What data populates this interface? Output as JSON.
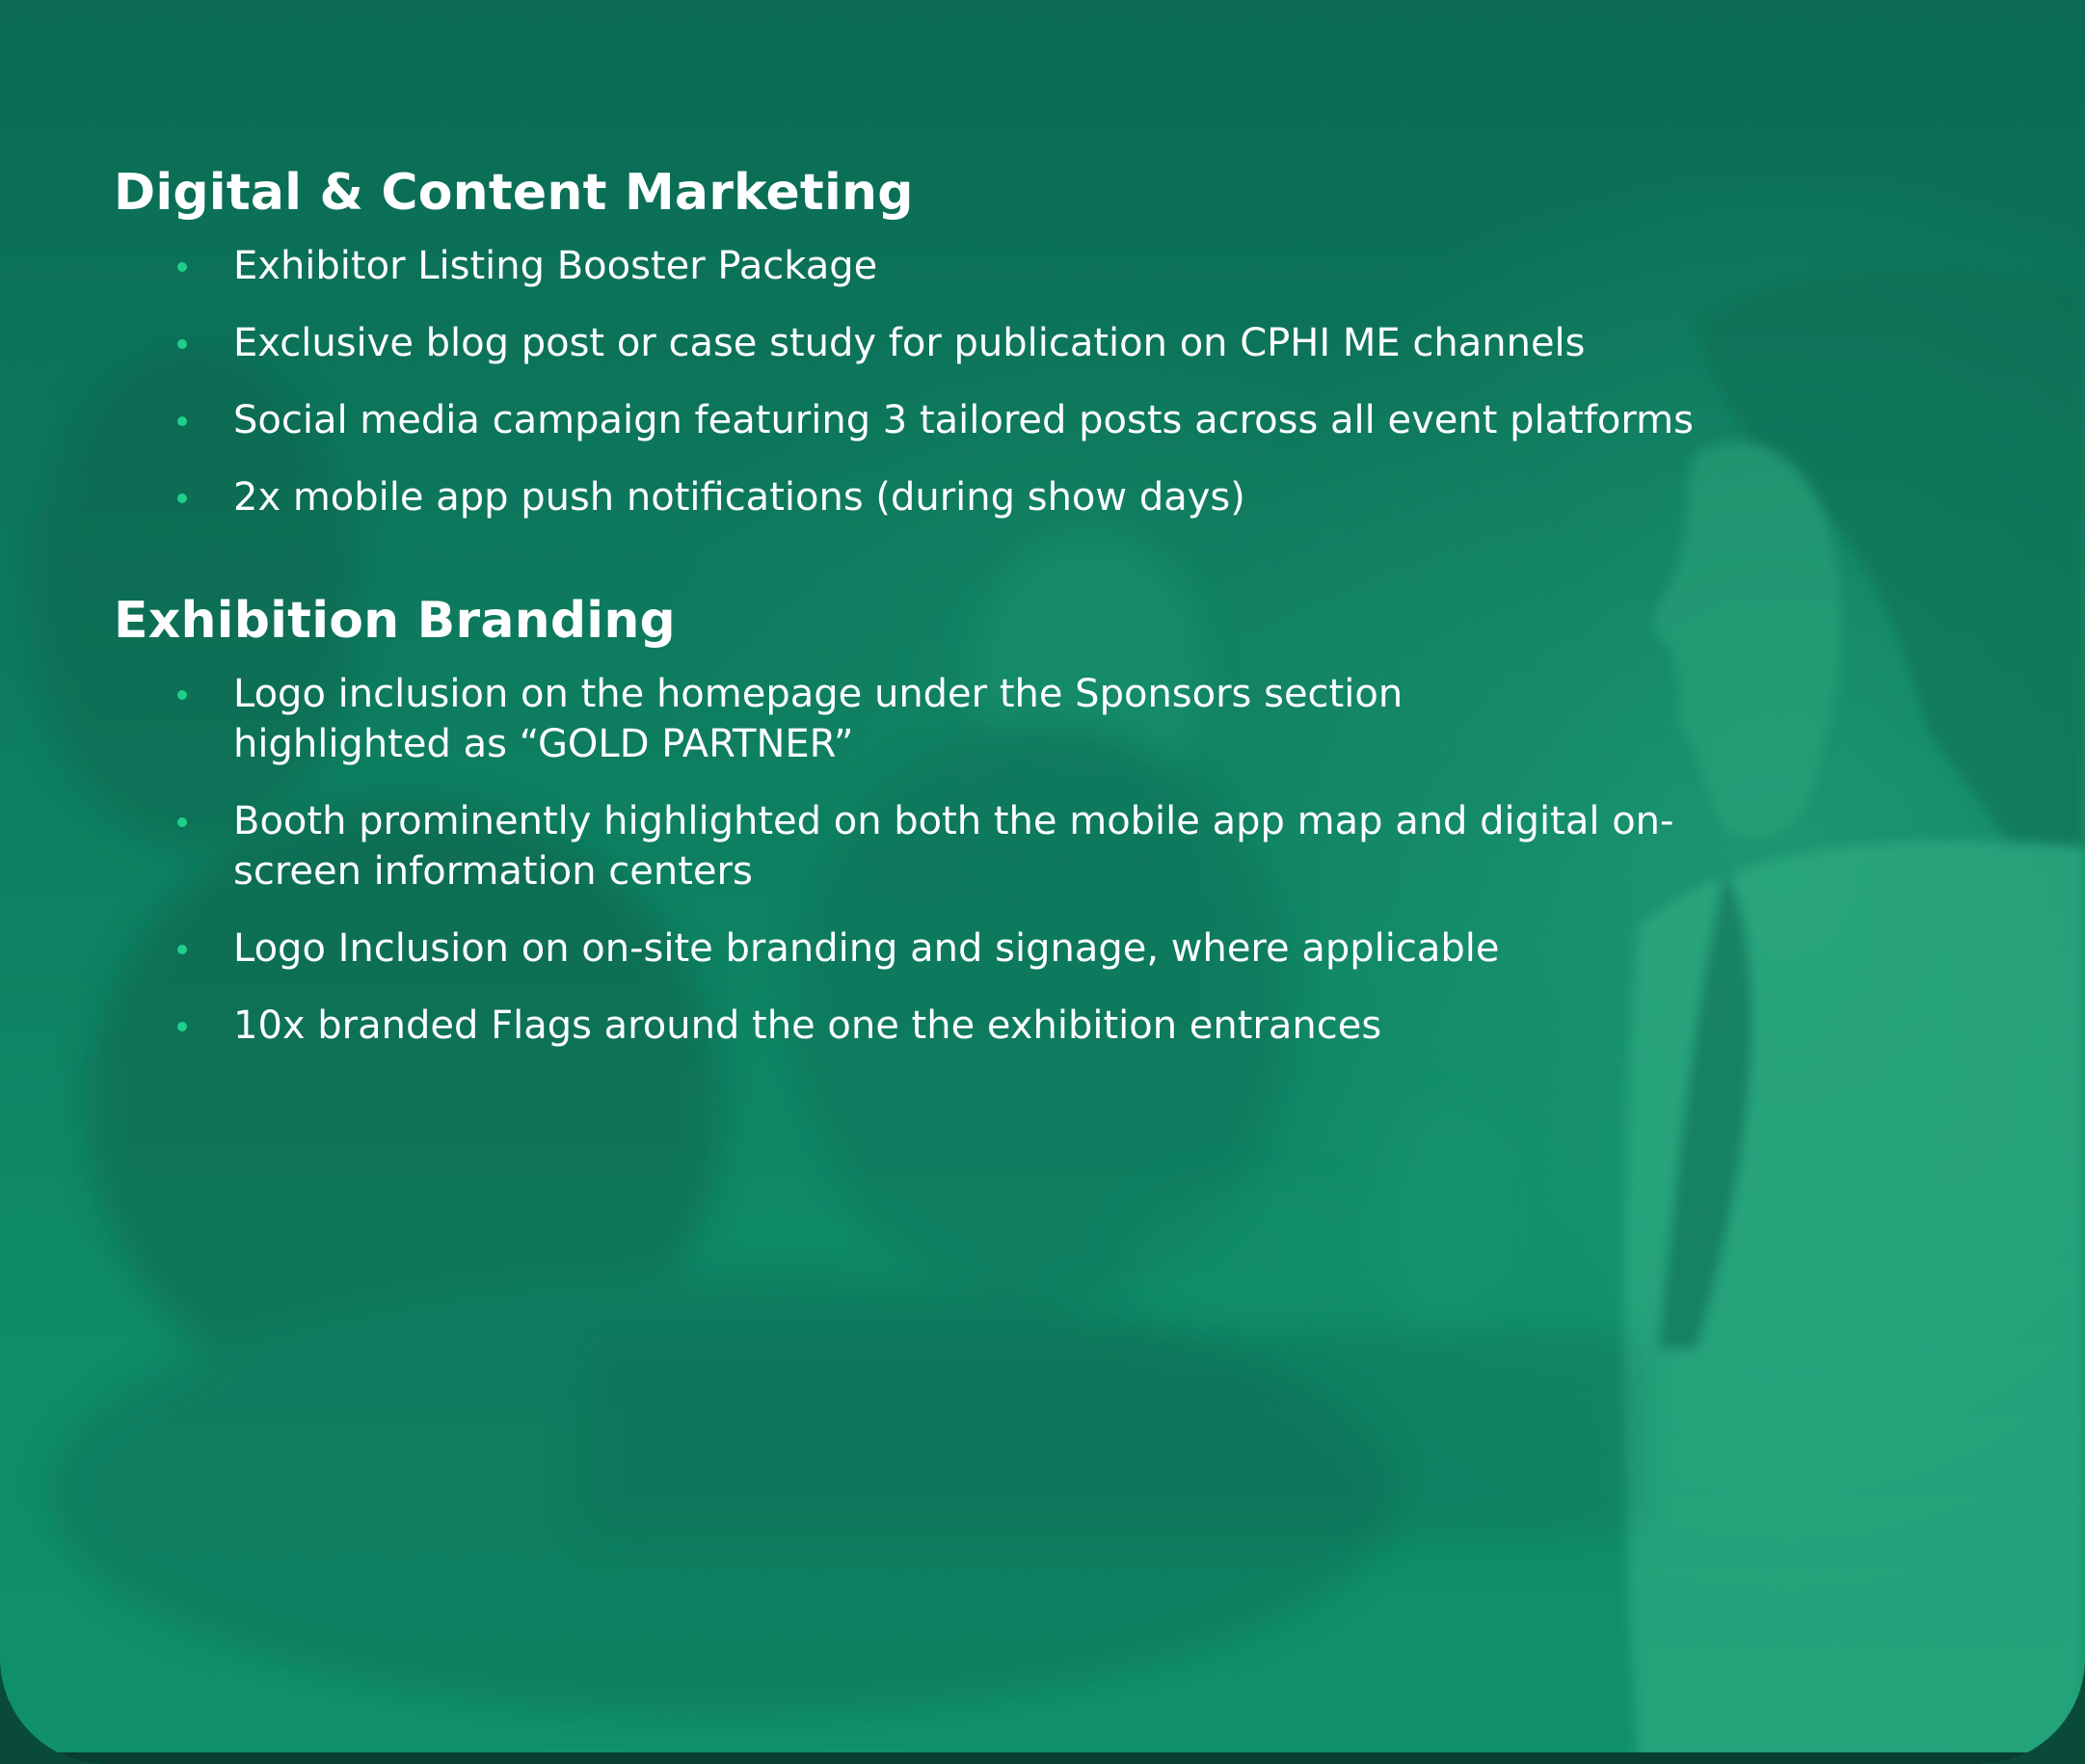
{
  "sections": [
    {
      "heading": "Digital & Content Marketing",
      "items": [
        "Exhibitor Listing Booster Package",
        "Exclusive blog post or case study for publication on CPHI ME channels",
        "Social media campaign featuring 3 tailored posts across all event platforms",
        "2x mobile app push notifications (during show days)"
      ]
    },
    {
      "heading": "Exhibition Branding",
      "items": [
        "Logo inclusion on the homepage under the Sponsors section highlighted as “GOLD PARTNER”",
        "Booth prominently highlighted on both the mobile app map and digital on-screen information centers",
        "Logo Inclusion on on-site branding and signage, where applicable",
        "10x branded Flags around the one the exhibition entrances"
      ]
    }
  ],
  "colors": {
    "background": "#0d7a5e",
    "bullet": "#1fcf8a",
    "text": "#ffffff"
  }
}
